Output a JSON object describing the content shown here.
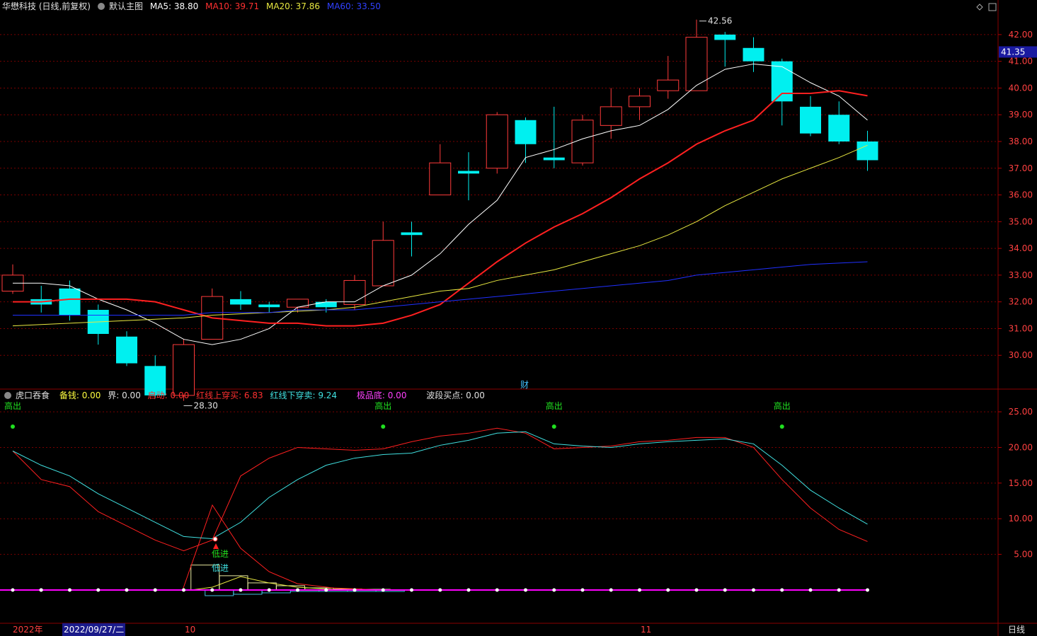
{
  "main_legend": {
    "title": "华懋科技 (日线,前复权)",
    "view": "默认主图",
    "ma5": "MA5: 38.80",
    "ma10": "MA10: 39.71",
    "ma20": "MA20: 37.86",
    "ma60": "MA60: 33.50"
  },
  "sub_legend": {
    "name": "虎口吞食",
    "items": [
      "备钱: 0.00",
      "界: 0.00",
      "启动: 0.00",
      "红线上穿买: 6.83",
      "红线下穿卖: 9.24",
      "极品底: 0.00",
      "波段买点: 0.00"
    ]
  },
  "price_badge": "41.35",
  "finance_marker": "财",
  "footer": {
    "year": "2022年",
    "cursor_date": "2022/09/27/二",
    "month_10": "10",
    "month_11": "11",
    "period": "日线"
  },
  "colors": {
    "up": "#ff3b3b",
    "down": "#00f0f0",
    "ma5": "#ffffff",
    "ma10": "#ff2020",
    "ma20": "#e8e840",
    "ma60": "#2030ff",
    "magenta": "#ff00ff",
    "grid": "#7a0000"
  },
  "chart_data": [
    {
      "type": "candlestick",
      "title": "华懋科技 (日线,前复权)",
      "ylim": [
        29.0,
        42.5
      ],
      "y_ticks": [
        "42.00",
        "41.00",
        "40.00",
        "39.00",
        "38.00",
        "37.00",
        "36.00",
        "35.00",
        "34.00",
        "33.00",
        "32.00",
        "31.00",
        "30.00"
      ],
      "annotations": {
        "high": "42.56",
        "low": "28.30"
      },
      "candles": [
        {
          "o": 32.4,
          "c": 33.0,
          "h": 33.4,
          "l": 32.3
        },
        {
          "o": 32.1,
          "c": 31.9,
          "h": 32.6,
          "l": 31.6
        },
        {
          "o": 32.5,
          "c": 31.5,
          "h": 32.8,
          "l": 31.3
        },
        {
          "o": 31.7,
          "c": 30.8,
          "h": 31.9,
          "l": 30.4
        },
        {
          "o": 30.7,
          "c": 29.7,
          "h": 30.9,
          "l": 29.6
        },
        {
          "o": 29.6,
          "c": 28.5,
          "h": 30.0,
          "l": 28.4
        },
        {
          "o": 28.5,
          "c": 30.4,
          "h": 30.6,
          "l": 28.3
        },
        {
          "o": 30.6,
          "c": 32.2,
          "h": 32.5,
          "l": 30.6
        },
        {
          "o": 32.1,
          "c": 31.9,
          "h": 32.4,
          "l": 31.7
        },
        {
          "o": 31.9,
          "c": 31.8,
          "h": 32.0,
          "l": 31.6
        },
        {
          "o": 31.8,
          "c": 32.1,
          "h": 32.1,
          "l": 31.6
        },
        {
          "o": 32.0,
          "c": 31.8,
          "h": 32.1,
          "l": 31.6
        },
        {
          "o": 31.9,
          "c": 32.8,
          "h": 33.0,
          "l": 31.7
        },
        {
          "o": 32.6,
          "c": 34.3,
          "h": 35.0,
          "l": 32.6
        },
        {
          "o": 34.6,
          "c": 34.5,
          "h": 35.0,
          "l": 33.7
        },
        {
          "o": 36.0,
          "c": 37.2,
          "h": 37.9,
          "l": 36.0
        },
        {
          "o": 36.9,
          "c": 36.8,
          "h": 37.6,
          "l": 35.8
        },
        {
          "o": 37.0,
          "c": 39.0,
          "h": 39.1,
          "l": 36.8
        },
        {
          "o": 38.8,
          "c": 37.9,
          "h": 38.9,
          "l": 37.2
        },
        {
          "o": 37.4,
          "c": 37.3,
          "h": 39.3,
          "l": 37.0
        },
        {
          "o": 37.2,
          "c": 38.8,
          "h": 39.0,
          "l": 37.1
        },
        {
          "o": 38.6,
          "c": 39.3,
          "h": 40.0,
          "l": 38.1
        },
        {
          "o": 39.3,
          "c": 39.7,
          "h": 40.0,
          "l": 38.8
        },
        {
          "o": 39.9,
          "c": 40.3,
          "h": 41.2,
          "l": 39.6
        },
        {
          "o": 39.9,
          "c": 41.9,
          "h": 42.56,
          "l": 39.9
        },
        {
          "o": 42.0,
          "c": 41.8,
          "h": 42.1,
          "l": 40.8
        },
        {
          "o": 41.5,
          "c": 41.0,
          "h": 41.9,
          "l": 40.6
        },
        {
          "o": 41.0,
          "c": 39.5,
          "h": 41.1,
          "l": 38.6
        },
        {
          "o": 39.3,
          "c": 38.3,
          "h": 39.7,
          "l": 38.2
        },
        {
          "o": 39.0,
          "c": 38.0,
          "h": 39.5,
          "l": 37.9
        },
        {
          "o": 38.0,
          "c": 37.3,
          "h": 38.4,
          "l": 36.9
        }
      ],
      "series": [
        {
          "name": "MA5",
          "values": [
            32.7,
            32.7,
            32.6,
            32.1,
            31.7,
            31.2,
            30.6,
            30.4,
            30.6,
            31.0,
            31.8,
            32.0,
            32.0,
            32.6,
            33.0,
            33.8,
            34.9,
            35.8,
            37.4,
            37.7,
            38.1,
            38.4,
            38.6,
            39.2,
            40.1,
            40.7,
            40.9,
            40.8,
            40.2,
            39.7,
            38.8
          ]
        },
        {
          "name": "MA10",
          "values": [
            32.0,
            32.0,
            32.1,
            32.1,
            32.1,
            32.0,
            31.7,
            31.4,
            31.3,
            31.2,
            31.2,
            31.1,
            31.1,
            31.2,
            31.5,
            31.9,
            32.7,
            33.5,
            34.2,
            34.8,
            35.3,
            35.9,
            36.6,
            37.2,
            37.9,
            38.4,
            38.8,
            39.8,
            39.8,
            39.9,
            39.71
          ]
        },
        {
          "name": "MA20",
          "values": [
            31.1,
            31.15,
            31.2,
            31.25,
            31.3,
            31.35,
            31.4,
            31.5,
            31.55,
            31.6,
            31.65,
            31.7,
            31.8,
            32.0,
            32.2,
            32.4,
            32.5,
            32.8,
            33.0,
            33.2,
            33.5,
            33.8,
            34.1,
            34.5,
            35.0,
            35.6,
            36.1,
            36.6,
            37.0,
            37.4,
            37.86
          ]
        },
        {
          "name": "MA60",
          "values": [
            31.5,
            31.5,
            31.5,
            31.5,
            31.5,
            31.5,
            31.5,
            31.6,
            31.6,
            31.6,
            31.7,
            31.7,
            31.7,
            31.8,
            31.9,
            32.0,
            32.1,
            32.2,
            32.3,
            32.4,
            32.5,
            32.6,
            32.7,
            32.8,
            33.0,
            33.1,
            33.2,
            33.3,
            33.4,
            33.45,
            33.5
          ]
        }
      ]
    },
    {
      "type": "line",
      "title": "虎口吞食",
      "ylim": [
        0,
        26
      ],
      "y_ticks": [
        "25.00",
        "20.00",
        "15.00",
        "10.00",
        "5.00"
      ],
      "labels": {
        "top": "高出",
        "low_red": "低进",
        "low_cyan": "低进"
      },
      "top_markers": [
        0,
        13,
        19,
        27
      ],
      "series": [
        {
          "name": "红线",
          "values": [
            19.5,
            15.5,
            14.5,
            11.0,
            9.0,
            7.0,
            5.5,
            7.0,
            16.0,
            18.5,
            20.0,
            19.8,
            19.6,
            19.8,
            20.8,
            21.6,
            22.0,
            22.7,
            22.0,
            19.8,
            20.0,
            20.2,
            20.8,
            21.0,
            21.4,
            21.4,
            20.0,
            15.5,
            11.5,
            8.5,
            6.8
          ]
        },
        {
          "name": "青线",
          "values": [
            19.5,
            17.5,
            16.0,
            13.5,
            11.5,
            9.5,
            7.5,
            7.2,
            9.5,
            13.0,
            15.5,
            17.5,
            18.5,
            19.0,
            19.2,
            20.3,
            21.0,
            22.0,
            22.2,
            20.5,
            20.2,
            20.0,
            20.5,
            20.8,
            21.0,
            21.2,
            20.5,
            17.5,
            14.0,
            11.5,
            9.24
          ]
        }
      ]
    }
  ]
}
